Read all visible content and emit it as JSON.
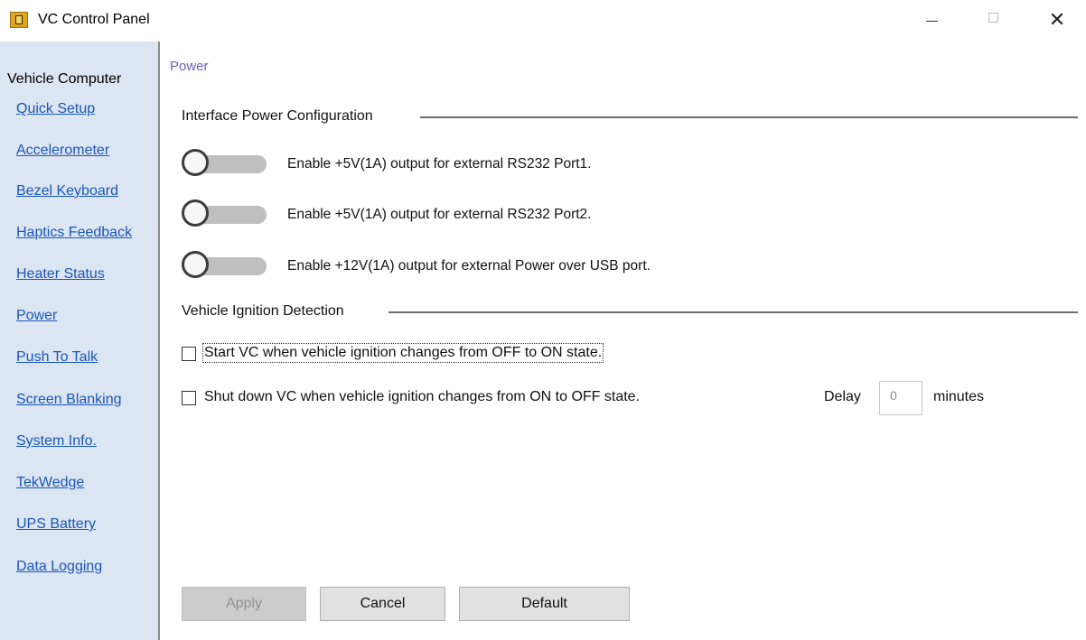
{
  "window": {
    "title": "VC Control Panel",
    "close_glyph": "✕"
  },
  "sidebar": {
    "heading": "Vehicle Computer",
    "items": [
      {
        "label": "Quick Setup"
      },
      {
        "label": "Accelerometer"
      },
      {
        "label": "Bezel Keyboard"
      },
      {
        "label": "Haptics Feedback"
      },
      {
        "label": "Heater Status"
      },
      {
        "label": "Power"
      },
      {
        "label": "Push To Talk"
      },
      {
        "label": "Screen Blanking"
      },
      {
        "label": "System Info."
      },
      {
        "label": "TekWedge"
      },
      {
        "label": "UPS Battery"
      },
      {
        "label": "Data Logging"
      }
    ]
  },
  "main": {
    "breadcrumb": "Power",
    "power_section": {
      "title": "Interface Power Configuration",
      "toggles": [
        {
          "label": "Enable +5V(1A) output for external RS232 Port1.",
          "on": false
        },
        {
          "label": "Enable +5V(1A) output for external RS232 Port2.",
          "on": false
        },
        {
          "label": "Enable +12V(1A) output for external Power over USB port.",
          "on": false
        }
      ]
    },
    "ignition_section": {
      "title": "Vehicle Ignition Detection",
      "start_checkbox": {
        "label": "Start VC when vehicle ignition changes from OFF to ON state.",
        "checked": false
      },
      "shutdown_checkbox": {
        "label": "Shut down VC when vehicle ignition changes from ON to OFF state.",
        "checked": false
      },
      "delay_label": "Delay",
      "delay_value": "0",
      "minutes_label": "minutes"
    },
    "buttons": {
      "apply": "Apply",
      "cancel": "Cancel",
      "default": "Default"
    }
  },
  "colors": {
    "sidebar_bg": "#dce6f2",
    "link": "#1a56b8",
    "breadcrumb": "#6b5fb5",
    "toggle_track": "#bfbfbf"
  }
}
